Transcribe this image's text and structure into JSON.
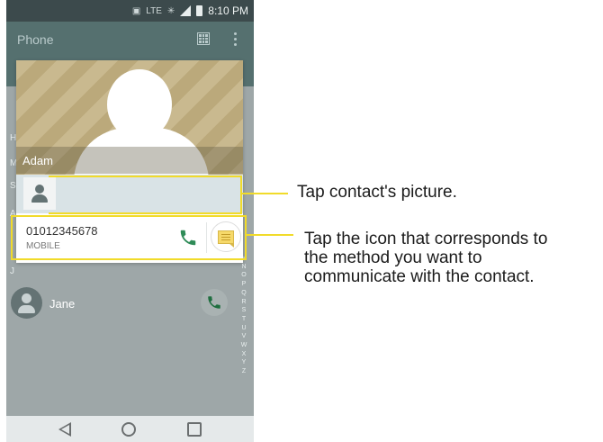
{
  "status_bar": {
    "network": "LTE",
    "time": "8:10 PM"
  },
  "app_bar": {
    "title": "Phone",
    "dialpad_icon": "dialpad-icon",
    "more_icon": "more-options-icon"
  },
  "side_letters": {
    "h": "H",
    "m": "M",
    "s": "S",
    "a": "A",
    "j": "J"
  },
  "index_letters": [
    "M",
    "N",
    "O",
    "P",
    "Q",
    "R",
    "S",
    "T",
    "U",
    "V",
    "W",
    "X",
    "Y",
    "Z"
  ],
  "contact_list": [
    {
      "name": "Jane"
    }
  ],
  "contact_card": {
    "name": "Adam",
    "number": "01012345678",
    "number_type": "MOBILE"
  },
  "callouts": {
    "picture": "Tap contact's picture.",
    "icon_line1": "Tap the icon that corresponds to",
    "icon_line2": "the method you want to",
    "icon_line3": "communicate with the contact."
  },
  "colors": {
    "highlight": "#f1db2a",
    "call_green": "#2e8b57",
    "app_bar": "#55706f"
  }
}
